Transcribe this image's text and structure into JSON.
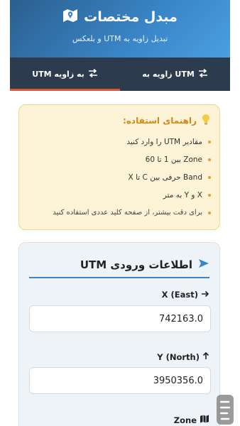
{
  "header": {
    "title": "مبدل مختصات",
    "subtitle": "تبدیل زاویه به UTM و بلعکس",
    "icon": "map-icon"
  },
  "tabs": [
    {
      "label": "UTM به زاویه",
      "icon": "swap-icon",
      "active": true
    },
    {
      "label": "زاویه به UTM",
      "icon": "swap-icon",
      "active": false
    }
  ],
  "guide": {
    "title": "راهنمای استفاده:",
    "icon": "lightbulb-icon",
    "items": [
      "مقادیر UTM را وارد کنید",
      "Zone بین 1 تا 60",
      "Band حرفی بین C تا X",
      "X و Y به متر",
      "برای دقت بیشتر، از صفحه کلید عددی استفاده کنید"
    ]
  },
  "input_card": {
    "title": "اطلاعات ورودی UTM",
    "icon": "send-icon",
    "x_label": "X (East)",
    "x_value": "742163.0",
    "y_label": "Y (North)",
    "y_value": "3950356.0",
    "zone_label": "Zone"
  },
  "colors": {
    "header_gradient_start": "#2b5f8e",
    "header_gradient_end": "#4aa0e0",
    "tab_bar": "#2d3b4e",
    "tab_active_underline": "#e4572e",
    "guide_bg": "#fdf3d6",
    "guide_title": "#d08a1a",
    "accent": "#3a86c8"
  }
}
